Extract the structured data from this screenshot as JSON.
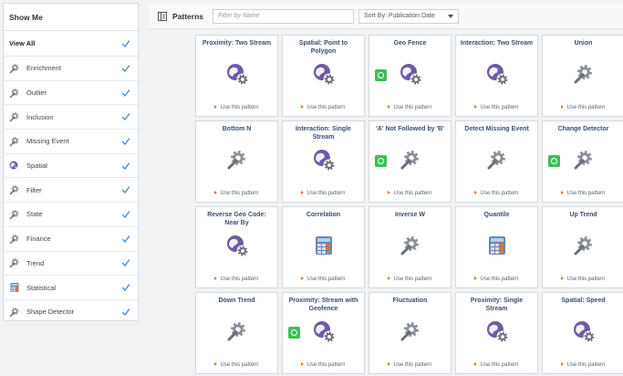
{
  "sidebar": {
    "title": "Show Me",
    "items": [
      {
        "label": "View All",
        "icon": "none",
        "checked": true
      },
      {
        "label": "Enrichment",
        "icon": "magnifier-gear-icon",
        "checked": true
      },
      {
        "label": "Outlier",
        "icon": "magnifier-gear-icon",
        "checked": true
      },
      {
        "label": "Inclusion",
        "icon": "magnifier-gear-icon",
        "checked": true
      },
      {
        "label": "Missing Event",
        "icon": "magnifier-gear-icon",
        "checked": true
      },
      {
        "label": "Spatial",
        "icon": "globe-icon",
        "checked": true
      },
      {
        "label": "Filter",
        "icon": "magnifier-gear-icon",
        "checked": true
      },
      {
        "label": "State",
        "icon": "magnifier-gear-icon",
        "checked": true
      },
      {
        "label": "Finance",
        "icon": "magnifier-gear-icon",
        "checked": true
      },
      {
        "label": "Trend",
        "icon": "magnifier-gear-icon",
        "checked": true
      },
      {
        "label": "Statistical",
        "icon": "calculator-icon",
        "checked": true
      },
      {
        "label": "Shape Detector",
        "icon": "magnifier-gear-icon",
        "checked": true
      }
    ]
  },
  "header": {
    "title": "Patterns",
    "filter_placeholder": "Filter by Name",
    "filter_value": "",
    "sort_label": "Sort By: Publication Date"
  },
  "cards": [
    {
      "title": "Proximity: Two Stream",
      "icon": "globe-gear-icon",
      "badge": false
    },
    {
      "title": "Spatial: Point to Polygon",
      "icon": "globe-gear-icon",
      "badge": false
    },
    {
      "title": "Geo Fence",
      "icon": "globe-gear-icon",
      "badge": true
    },
    {
      "title": "Interaction: Two Stream",
      "icon": "globe-gear-icon",
      "badge": false
    },
    {
      "title": "Union",
      "icon": "wrench-gear-icon",
      "badge": false
    },
    {
      "title": "Bottom N",
      "icon": "wrench-gear-icon",
      "badge": false
    },
    {
      "title": "Interaction: Single Stream",
      "icon": "globe-gear-icon",
      "badge": false
    },
    {
      "title": "'A' Not Followed by 'B'",
      "icon": "wrench-gear-icon",
      "badge": true
    },
    {
      "title": "Detect Missing Event",
      "icon": "wrench-gear-icon",
      "badge": false
    },
    {
      "title": "Change Detector",
      "icon": "wrench-gear-icon",
      "badge": true
    },
    {
      "title": "Reverse Geo Code: Near By",
      "icon": "globe-gear-icon",
      "badge": false
    },
    {
      "title": "Correlation",
      "icon": "calculator-icon",
      "badge": false
    },
    {
      "title": "Inverse W",
      "icon": "wrench-gear-icon",
      "badge": false
    },
    {
      "title": "Quantile",
      "icon": "calculator-icon",
      "badge": false
    },
    {
      "title": "Up Trend",
      "icon": "wrench-gear-icon",
      "badge": false
    },
    {
      "title": "Down Trend",
      "icon": "wrench-gear-icon",
      "badge": false
    },
    {
      "title": "Proximity: Stream with Geofence",
      "icon": "globe-gear-icon",
      "badge": true
    },
    {
      "title": "Fluctuation",
      "icon": "wrench-gear-icon",
      "badge": false
    },
    {
      "title": "Proximity: Single Stream",
      "icon": "globe-gear-icon",
      "badge": false
    },
    {
      "title": "Spatial: Speed",
      "icon": "globe-gear-icon",
      "badge": false
    }
  ],
  "use_label": "Use this pattern",
  "colors": {
    "accent_blue": "#3a7bd5",
    "title_text": "#3a4e6e",
    "globe_purple": "#6e5aa8",
    "gear_gray": "#8a8f99",
    "badge_green": "#3cbf5a",
    "arrow_orange": "#e8762d"
  }
}
